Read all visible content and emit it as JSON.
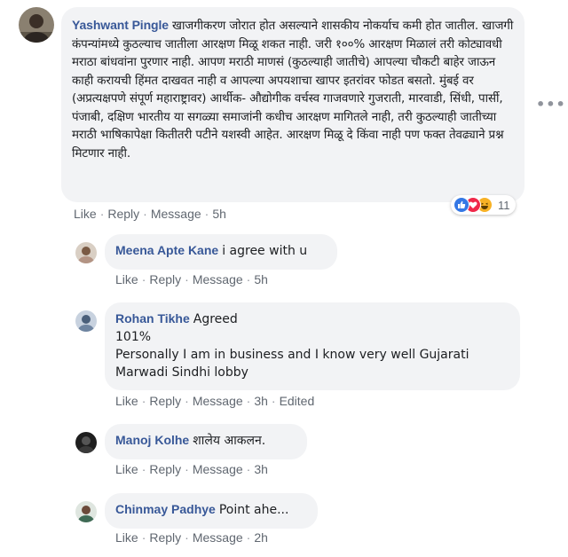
{
  "main_comment": {
    "author": "Yashwant Pingle",
    "text": "खाजगीकरण जोरात होत असल्याने शासकीय नोकर्याच कमी होत जातील. खाजगी कंपन्यांमध्ये कुठल्याच जातीला आरक्षण मिळू शकत नाही. जरी १००% आरक्षण मिळालं तरी कोट्यावधी मराठा बांधवांना पुरणार नाही. आपण मराठी माणसं (कुठल्याही जातीचे) आपल्या चौकटी बाहेर जाऊन काही करायची हिंमत दाखवत नाही व आपल्या अपयशाचा खापर इतरांवर फोडत बसतो. मुंबई वर (अप्रत्यक्षपणे संपूर्ण महाराष्ट्रावर) आर्थीक- औद्योगीक वर्चस्व गाजवणारे गुजराती, मारवाडी, सिंधी, पार्सी, पंजाबी, दक्षिण भारतीय या सगळ्या समाजांनी कधीच आरक्षण मागितले नाही, तरी कुठल्याही जातीच्या मराठी भाषिकापेक्षा कितीतरी पटीने यशस्वी आहेत. आरक्षण मिळू दे किंवा नाही पण फक्त तेवढ्याने प्रश्न मिटणार नाही.",
    "actions": {
      "like": "Like",
      "reply": "Reply",
      "message": "Message",
      "time": "5h"
    },
    "reaction_count": "11",
    "more": "•••"
  },
  "replies": [
    {
      "author": "Meena Apte Kane",
      "lines": [
        "i agree with u"
      ],
      "actions": {
        "like": "Like",
        "reply": "Reply",
        "message": "Message",
        "time": "5h"
      }
    },
    {
      "author": "Rohan Tikhe",
      "lines": [
        "Agreed",
        "101%",
        "Personally I am in business and I know very well Gujarati",
        "Marwadi Sindhi lobby"
      ],
      "actions": {
        "like": "Like",
        "reply": "Reply",
        "message": "Message",
        "time": "3h",
        "edited": "Edited"
      }
    },
    {
      "author": "Manoj Kolhe",
      "lines": [
        "शालेय आकलन."
      ],
      "actions": {
        "like": "Like",
        "reply": "Reply",
        "message": "Message",
        "time": "3h"
      }
    },
    {
      "author": "Chinmay Padhye",
      "lines": [
        "Point ahe..."
      ],
      "actions": {
        "like": "Like",
        "reply": "Reply",
        "message": "Message",
        "time": "2h"
      }
    }
  ],
  "colors": {
    "author": "#385898",
    "bubble": "#f2f3f5",
    "meta": "#606770",
    "like": "#3578e5",
    "love": "#f0284a",
    "haha": "#f7b125"
  },
  "icons": {
    "reactions": [
      "like-icon",
      "love-icon",
      "haha-icon"
    ]
  }
}
